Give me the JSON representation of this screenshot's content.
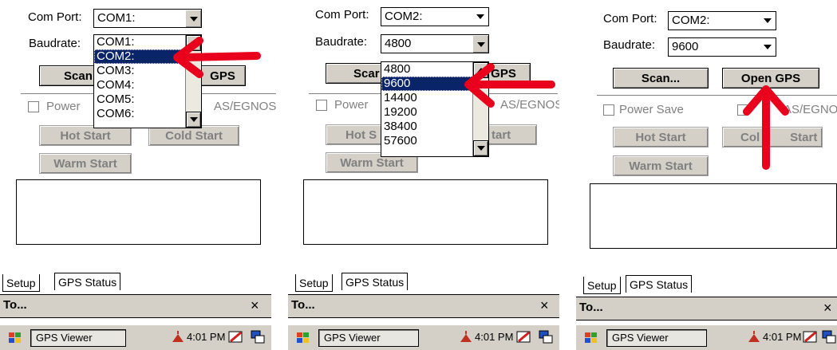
{
  "labels": {
    "com_port": "Com Port:",
    "baudrate": "Baudrate:"
  },
  "panel1": {
    "com_value": "COM1:",
    "com_options": [
      "COM1:",
      "COM2:",
      "COM3:",
      "COM4:",
      "COM5:",
      "COM6:"
    ],
    "com_selected_index": 1,
    "scan_partial": "Scan",
    "gps_partial": "GPS",
    "power_partial": "Power",
    "sbas_partial": "AS/EGNOS",
    "hot_start": "Hot Start",
    "cold_start": "Cold Start",
    "warm_start": "Warm Start"
  },
  "panel2": {
    "com_value": "COM2:",
    "baud_value": "4800",
    "baud_options": [
      "4800",
      "9600",
      "14400",
      "19200",
      "38400",
      "57600"
    ],
    "baud_selected_index": 1,
    "scan_partial": "Scar",
    "gps_partial": "GPS",
    "power_partial": "Power",
    "sbas_partial": "AS/EGNOS",
    "hot_partial": "Hot S",
    "cold_partial": "tart",
    "warm_start": "Warm Start"
  },
  "panel3": {
    "com_value": "COM2:",
    "baud_value": "9600",
    "scan": "Scan...",
    "open_gps": "Open GPS",
    "power_save": "Power Save",
    "sbas_partial": "AS/EGNOS",
    "hot_start": "Hot Start",
    "cold_partial": "Col",
    "cold_partial2": "Start",
    "warm_start": "Warm Start"
  },
  "tabs": {
    "setup": "Setup",
    "gps_status": "GPS Status"
  },
  "tobar": {
    "title": "To...",
    "close": "×"
  },
  "taskbar": {
    "app": "GPS Viewer",
    "time": "4:01 PM"
  },
  "colors": {
    "highlight": "#0a246a",
    "arrow": "#e8001c",
    "face": "#d4d0c8"
  },
  "icons": [
    "windows-start-icon",
    "gps-satellite-icon",
    "connection-icon",
    "window-switch-icon",
    "dropdown-arrow-icon",
    "red-arrow-annotation"
  ]
}
